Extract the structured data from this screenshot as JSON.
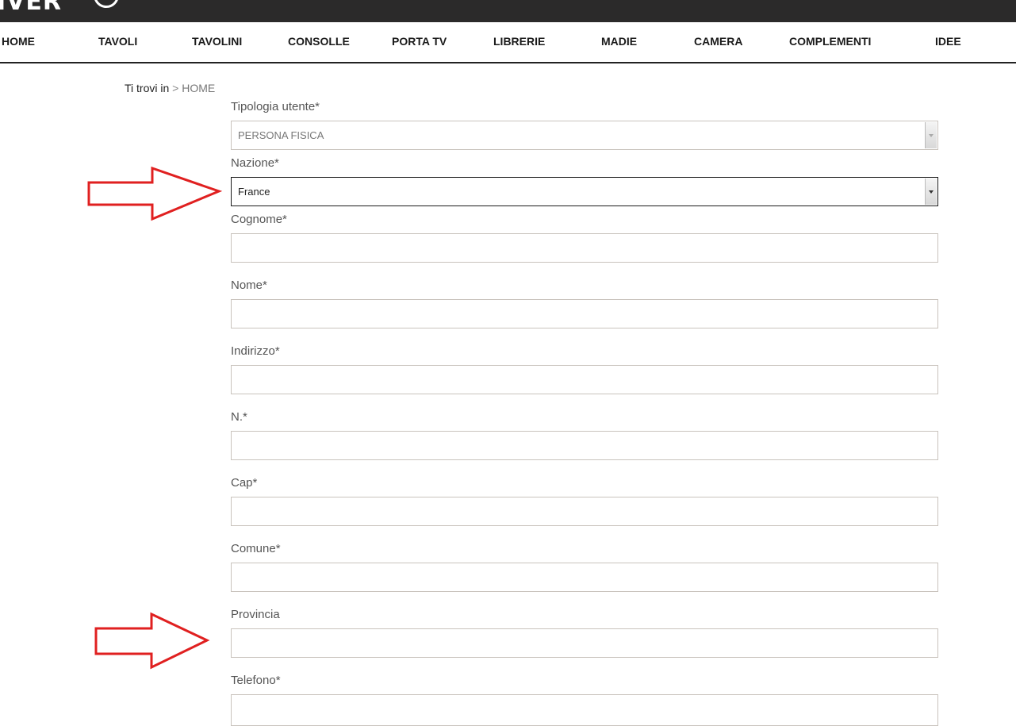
{
  "brand": {
    "logo_text": "IVER"
  },
  "nav": {
    "items": [
      "HOME",
      "TAVOLI",
      "TAVOLINI",
      "CONSOLLE",
      "PORTA TV",
      "LIBRERIE",
      "MADIE",
      "CAMERA",
      "COMPLEMENTI",
      "IDEE"
    ]
  },
  "breadcrumb": {
    "lead": "Ti trovi in",
    "separator": ">",
    "current": "HOME"
  },
  "form": {
    "tipologia": {
      "label": "Tipologia utente*",
      "value": "PERSONA FISICA"
    },
    "nazione": {
      "label": "Nazione*",
      "value": "France"
    },
    "cognome": {
      "label": "Cognome*",
      "value": ""
    },
    "nome": {
      "label": "Nome*",
      "value": ""
    },
    "indirizzo": {
      "label": "Indirizzo*",
      "value": ""
    },
    "numero": {
      "label": "N.*",
      "value": ""
    },
    "cap": {
      "label": "Cap*",
      "value": ""
    },
    "comune": {
      "label": "Comune*",
      "value": ""
    },
    "provincia": {
      "label": "Provincia",
      "value": ""
    },
    "telefono": {
      "label": "Telefono*",
      "value": ""
    }
  },
  "annotation": {
    "arrow_color": "#e02020"
  },
  "icons": {
    "select_arrow": "chevron-down-icon",
    "annotation_arrow": "arrow-right-icon"
  }
}
